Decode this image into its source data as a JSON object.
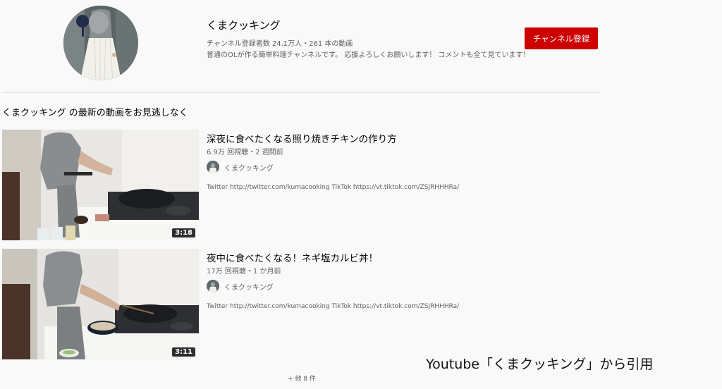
{
  "channel": {
    "name": "くまクッキング",
    "stats": "チャンネル登録者数 24.1万人・261 本の動画",
    "description": "普通のOLが作る簡単料理チャンネルです。 応援よろしくお願いします！ コメントも全て見ています！",
    "subscribe_label": "チャンネル登録",
    "avatar_icon": "channel-avatar-icon"
  },
  "section": {
    "title": "くまクッキング の最新の動画をお見逃しなく"
  },
  "videos": [
    {
      "title": "深夜に食べたくなる照り焼きチキンの作り方",
      "meta": "6.9万 回視聴・2 週間前",
      "channel": "くまクッキング",
      "description": "Twitter http://twitter.com/kumacooking TikTok https://vt.tiktok.com/ZSJRHHHRa/",
      "duration": "3:18"
    },
    {
      "title": "夜中に食べたくなる！ネギ塩カルビ丼！",
      "meta": "17万 回視聴・1 か月前",
      "channel": "くまクッキング",
      "description": "Twitter http://twitter.com/kumacooking TikTok https://vt.tiktok.com/ZSJRHHHRa/",
      "duration": "3:11"
    }
  ],
  "more_label": "+ 他 8 件",
  "credit": "Youtube「くまクッキング」から引用",
  "colors": {
    "subscribe": "#cc0000",
    "background": "#f9f9f9"
  }
}
